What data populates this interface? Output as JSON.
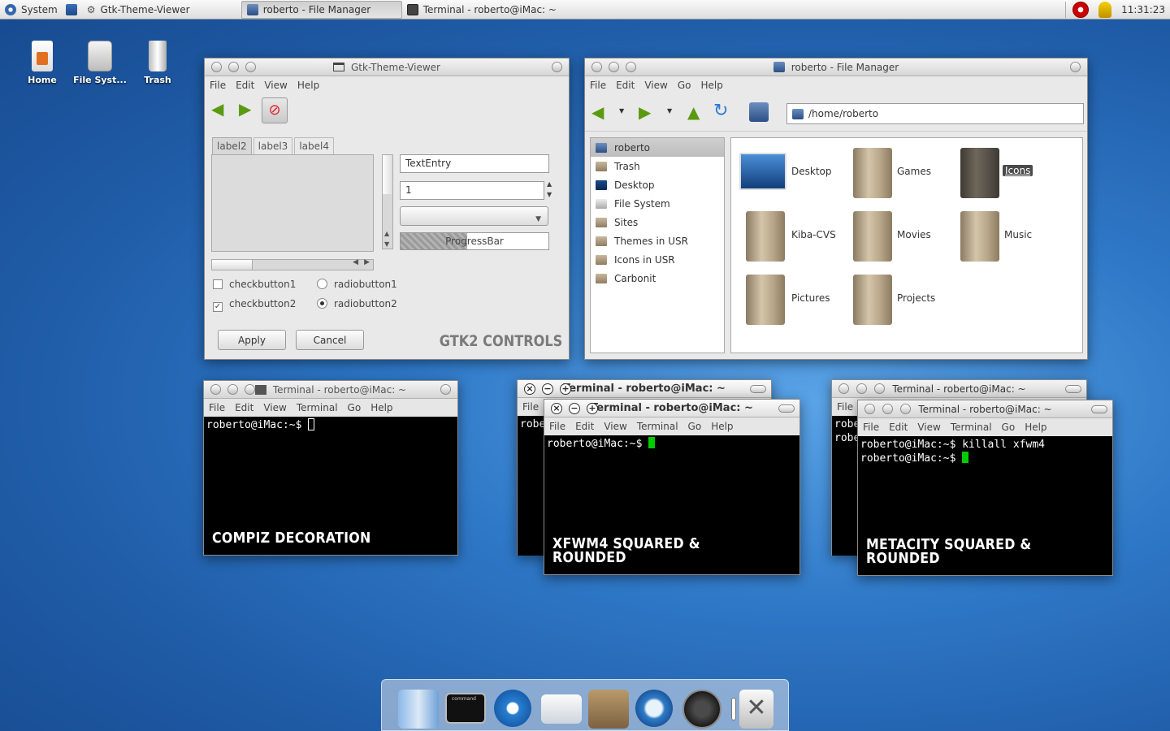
{
  "panel": {
    "system_label": "System",
    "tasks": [
      "Gtk-Theme-Viewer",
      "roberto - File Manager",
      "Terminal - roberto@iMac: ~"
    ],
    "clock": "11:31:23"
  },
  "desktop_icons": [
    {
      "label": "Home"
    },
    {
      "label": "File Syst..."
    },
    {
      "label": "Trash"
    }
  ],
  "gtk_viewer": {
    "title": "Gtk-Theme-Viewer",
    "menu": [
      "File",
      "Edit",
      "View",
      "Help"
    ],
    "tabs": [
      "label2",
      "label3",
      "label4"
    ],
    "text_entry": "TextEntry",
    "spin_value": "1",
    "progress_label": "ProgressBar",
    "progress_value": 0.45,
    "check1": "checkbutton1",
    "check2": "checkbutton2",
    "radio1": "radiobutton1",
    "radio2": "radiobutton2",
    "apply": "Apply",
    "cancel": "Cancel",
    "caption": "GTK2 CONTROLS"
  },
  "file_manager": {
    "title": "roberto - File Manager",
    "menu": [
      "File",
      "Edit",
      "View",
      "Go",
      "Help"
    ],
    "location": "/home/roberto",
    "sidebar": [
      "roberto",
      "Trash",
      "Desktop",
      "File System",
      "Sites",
      "Themes in USR",
      "Icons in USR",
      "Carbonit"
    ],
    "files": [
      "Desktop",
      "Games",
      "Icons",
      "Kiba-CVS",
      "Movies",
      "Music",
      "Pictures",
      "Projects"
    ]
  },
  "term1": {
    "title": "Terminal - roberto@iMac: ~",
    "menu": [
      "File",
      "Edit",
      "View",
      "Terminal",
      "Go",
      "Help"
    ],
    "prompt": "roberto@iMac:~$",
    "caption": "COMPIZ DECORATION"
  },
  "term2": {
    "back_title": "Terminal - roberto@iMac: ~",
    "back_menu": "File",
    "back_line": "robe",
    "title": "Terminal - roberto@iMac: ~",
    "menu": [
      "File",
      "Edit",
      "View",
      "Terminal",
      "Go",
      "Help"
    ],
    "prompt": "roberto@iMac:~$",
    "caption": "XFWM4 SQUARED & ROUNDED"
  },
  "term3": {
    "back_title": "Terminal - roberto@iMac: ~",
    "back_menu": "File",
    "back_line1": "robe",
    "back_line2": "robe",
    "title": "Terminal - roberto@iMac: ~",
    "menu": [
      "File",
      "Edit",
      "View",
      "Terminal",
      "Go",
      "Help"
    ],
    "line1": "roberto@iMac:~$ killall xfwm4",
    "prompt": "roberto@iMac:~$",
    "caption": "METACITY SQUARED & ROUNDED"
  },
  "dock": {
    "terminal_text": "command"
  },
  "colors": {
    "desktop": "#2f79c8",
    "cursor": "#00cc00",
    "selection": "#4a4a4a"
  }
}
